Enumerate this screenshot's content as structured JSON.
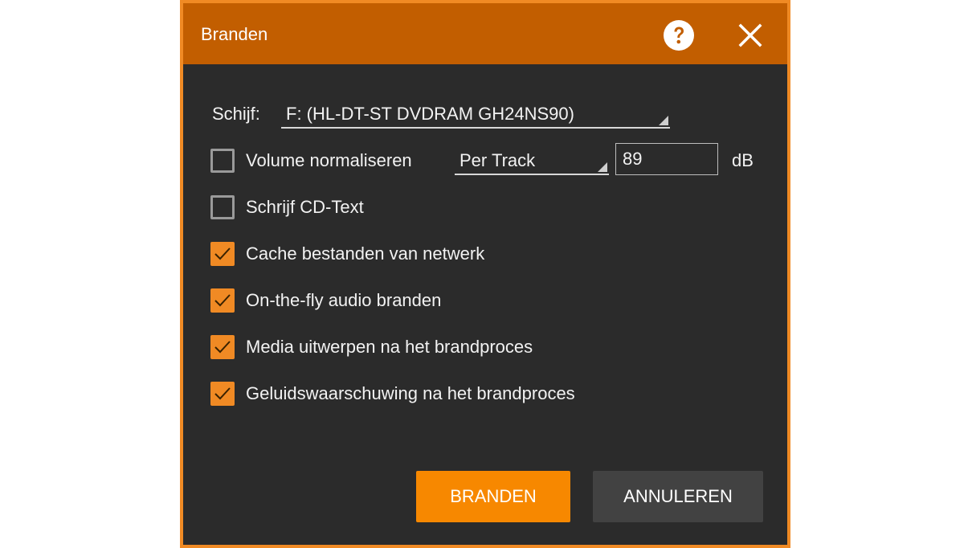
{
  "dialog": {
    "title": "Branden",
    "help_icon": "question-circle-icon",
    "close_icon": "close-x-icon"
  },
  "drive": {
    "label": "Schijf:",
    "value": "F: (HL-DT-ST DVDRAM GH24NS90)"
  },
  "options": {
    "normalize": {
      "label": "Volume normaliseren",
      "checked": false
    },
    "normalize_mode": "Per Track",
    "normalize_level": "89",
    "normalize_unit": "dB",
    "cd_text": {
      "label": "Schrijf CD-Text",
      "checked": false
    },
    "cache": {
      "label": "Cache bestanden van netwerk",
      "checked": true
    },
    "on_the_fly": {
      "label": "On-the-fly audio branden",
      "checked": true
    },
    "eject": {
      "label": "Media uitwerpen na het brandproces",
      "checked": true
    },
    "sound": {
      "label": "Geluidswaarschuwing na het brandproces",
      "checked": true
    }
  },
  "buttons": {
    "burn": "BRANDEN",
    "cancel": "ANNULEREN"
  },
  "colors": {
    "accent": "#f78800",
    "titlebar": "#c25e00",
    "background": "#2b2b2b",
    "border": "#f08a24"
  }
}
